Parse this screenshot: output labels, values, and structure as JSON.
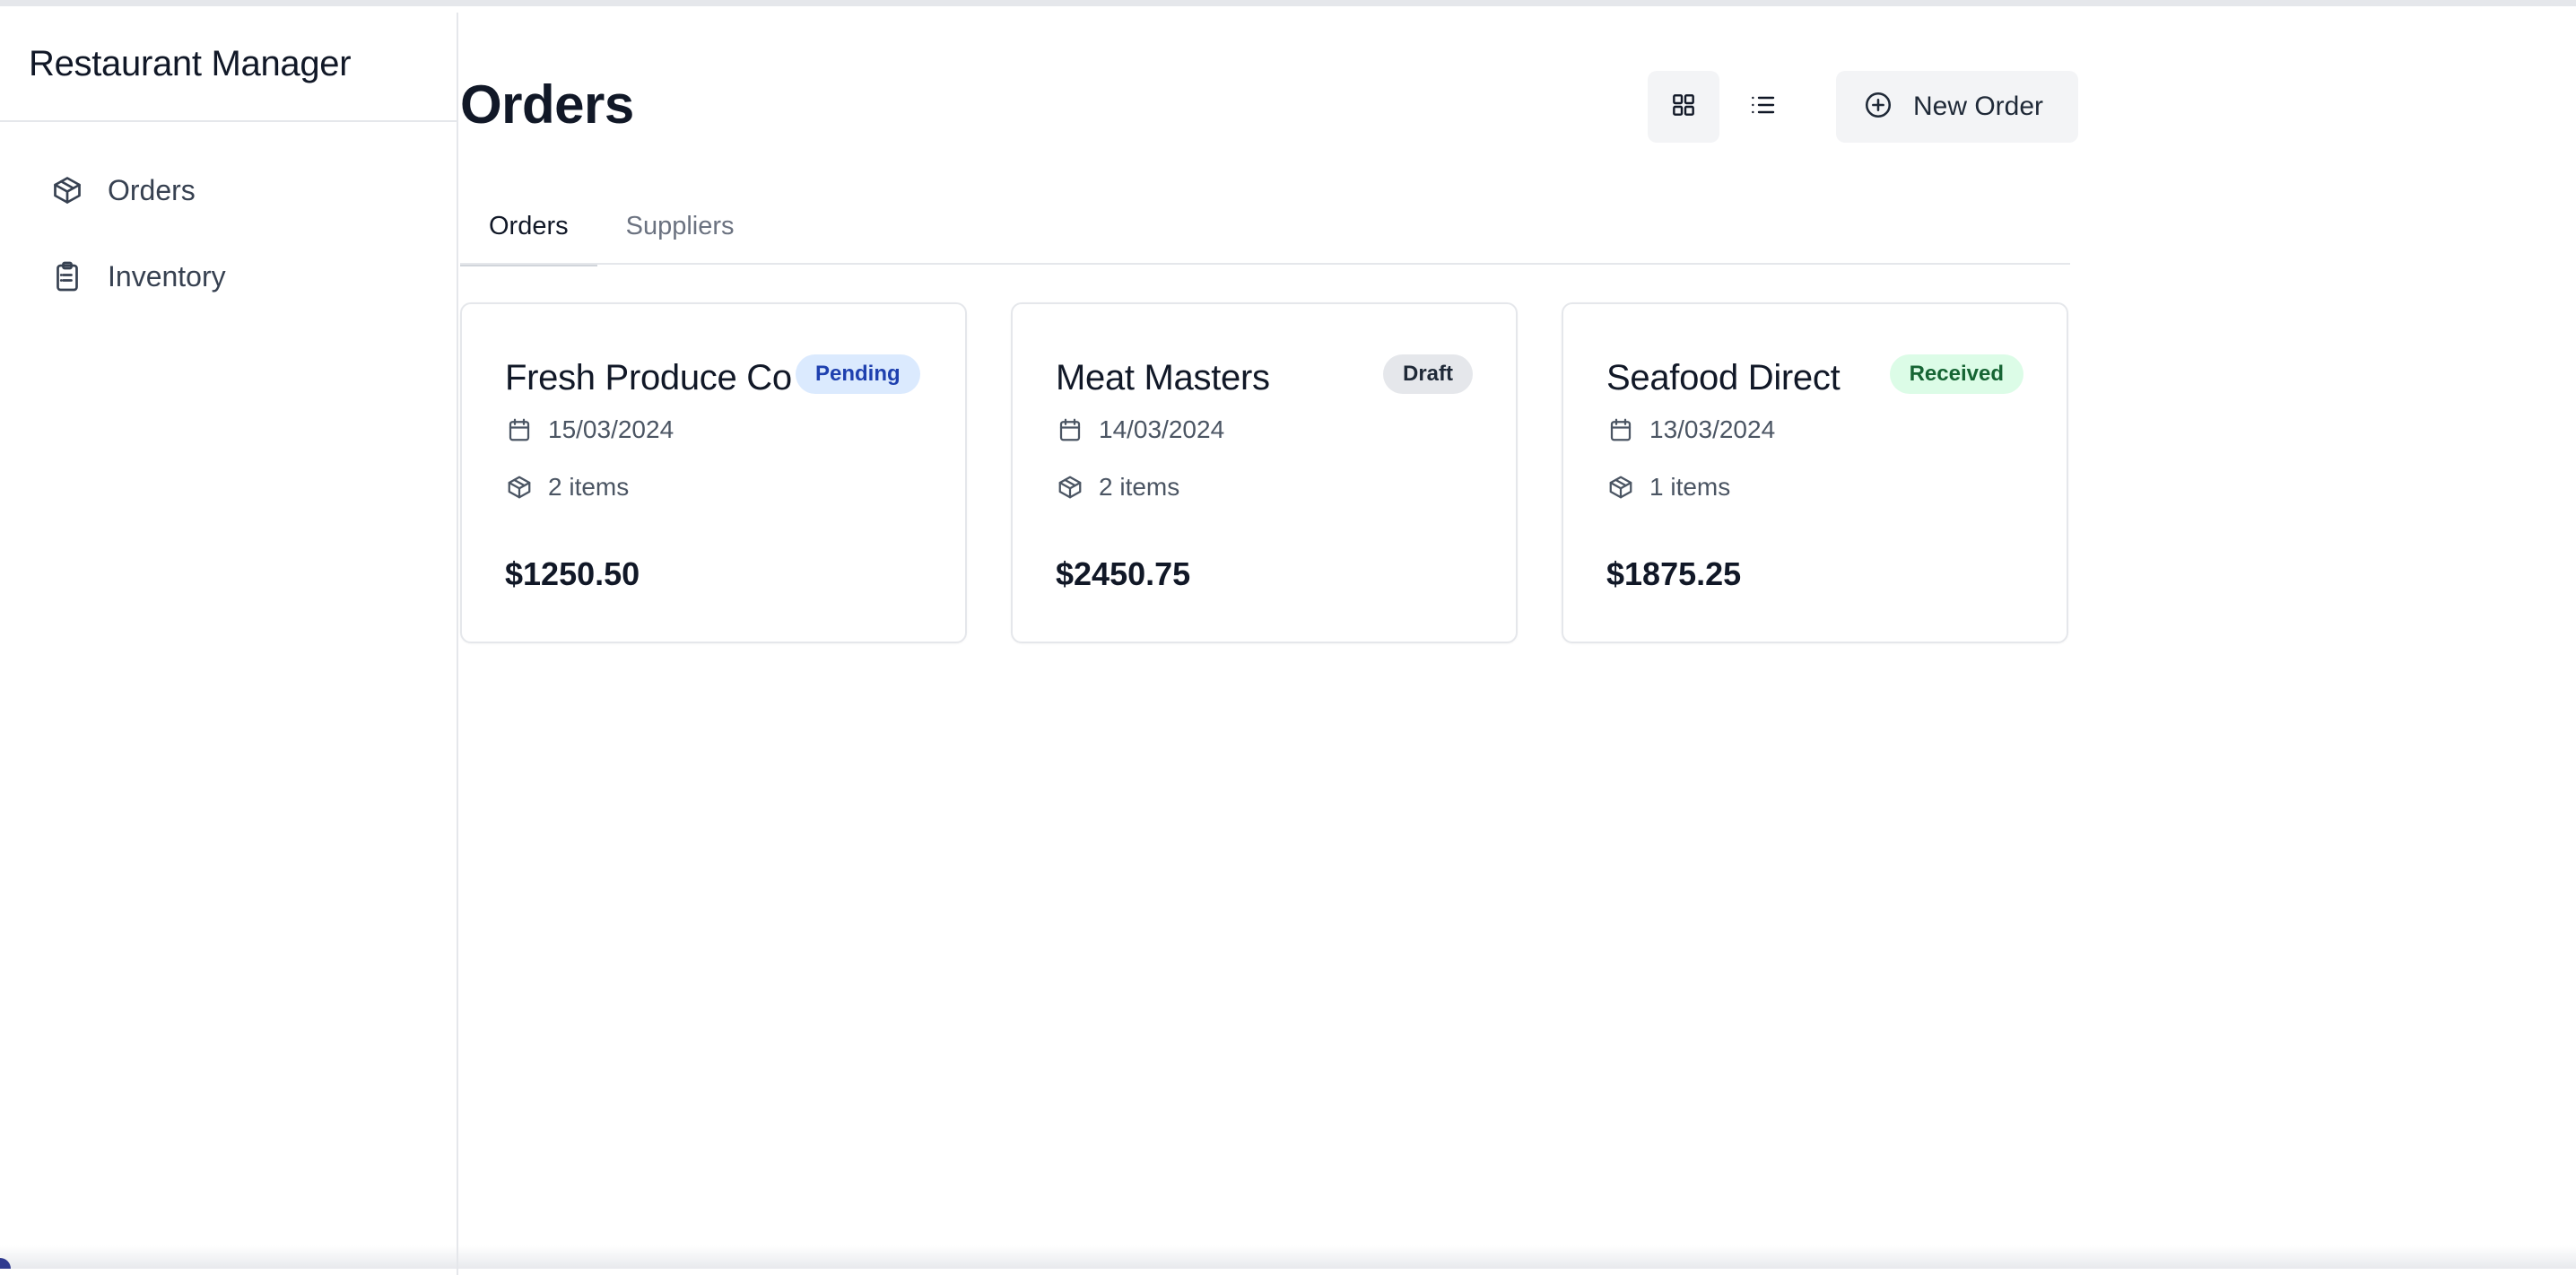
{
  "app": {
    "title": "Restaurant Manager"
  },
  "sidebar": {
    "items": [
      {
        "label": "Orders",
        "icon": "package-icon"
      },
      {
        "label": "Inventory",
        "icon": "clipboard-list-icon"
      }
    ]
  },
  "page": {
    "title": "Orders"
  },
  "toolbar": {
    "grid_view_icon": "grid-icon",
    "list_view_icon": "list-icon",
    "active_view": "grid",
    "new_order_label": "New Order",
    "new_order_icon": "plus-circle-icon"
  },
  "tabs": [
    {
      "label": "Orders",
      "active": true
    },
    {
      "label": "Suppliers",
      "active": false
    }
  ],
  "orders": [
    {
      "supplier": "Fresh Produce Co",
      "status": "Pending",
      "date": "15/03/2024",
      "items": "2 items",
      "total": "$1250.50"
    },
    {
      "supplier": "Meat Masters",
      "status": "Draft",
      "date": "14/03/2024",
      "items": "2 items",
      "total": "$2450.75"
    },
    {
      "supplier": "Seafood Direct",
      "status": "Received",
      "date": "13/03/2024",
      "items": "1 items",
      "total": "$1875.25"
    }
  ],
  "colors": {
    "pending_bg": "#dbeafe",
    "pending_text": "#1e40af",
    "draft_bg": "#e5e7eb",
    "draft_text": "#1f2937",
    "received_bg": "#dcfce7",
    "received_text": "#166534",
    "border": "#e5e7eb",
    "text_primary": "#111827",
    "text_secondary": "#4b5563"
  }
}
